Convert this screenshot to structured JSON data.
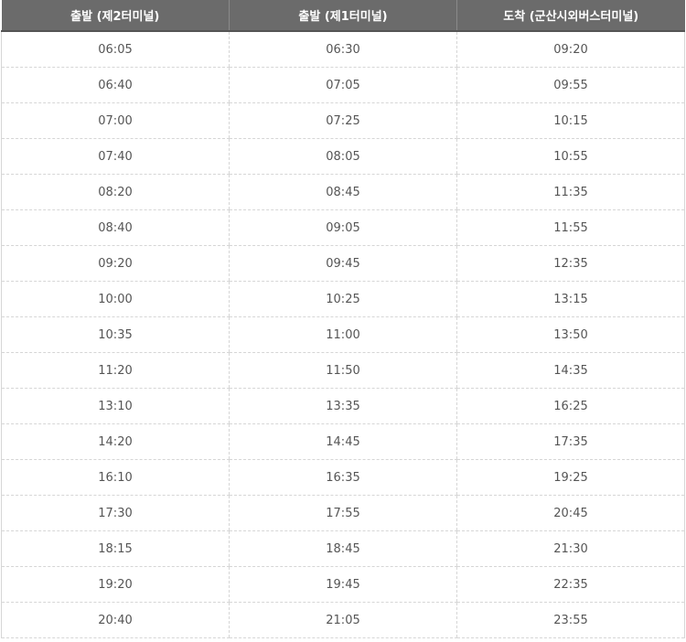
{
  "table": {
    "headers": [
      "출발 (제2터미널)",
      "출발 (제1터미널)",
      "도착 (군산시외버스터미널)"
    ],
    "rows": [
      [
        "06:05",
        "06:30",
        "09:20"
      ],
      [
        "06:40",
        "07:05",
        "09:55"
      ],
      [
        "07:00",
        "07:25",
        "10:15"
      ],
      [
        "07:40",
        "08:05",
        "10:55"
      ],
      [
        "08:20",
        "08:45",
        "11:35"
      ],
      [
        "08:40",
        "09:05",
        "11:55"
      ],
      [
        "09:20",
        "09:45",
        "12:35"
      ],
      [
        "10:00",
        "10:25",
        "13:15"
      ],
      [
        "10:35",
        "11:00",
        "13:50"
      ],
      [
        "11:20",
        "11:50",
        "14:35"
      ],
      [
        "13:10",
        "13:35",
        "16:25"
      ],
      [
        "14:20",
        "14:45",
        "17:35"
      ],
      [
        "16:10",
        "16:35",
        "19:25"
      ],
      [
        "17:30",
        "17:55",
        "20:45"
      ],
      [
        "18:15",
        "18:45",
        "21:30"
      ],
      [
        "19:20",
        "19:45",
        "22:35"
      ],
      [
        "20:40",
        "21:05",
        "23:55"
      ]
    ]
  },
  "colors": {
    "header_background": "#6b6b6b",
    "header_text": "#ffffff",
    "cell_text": "#555555",
    "grid_line": "#d6d6d6"
  }
}
